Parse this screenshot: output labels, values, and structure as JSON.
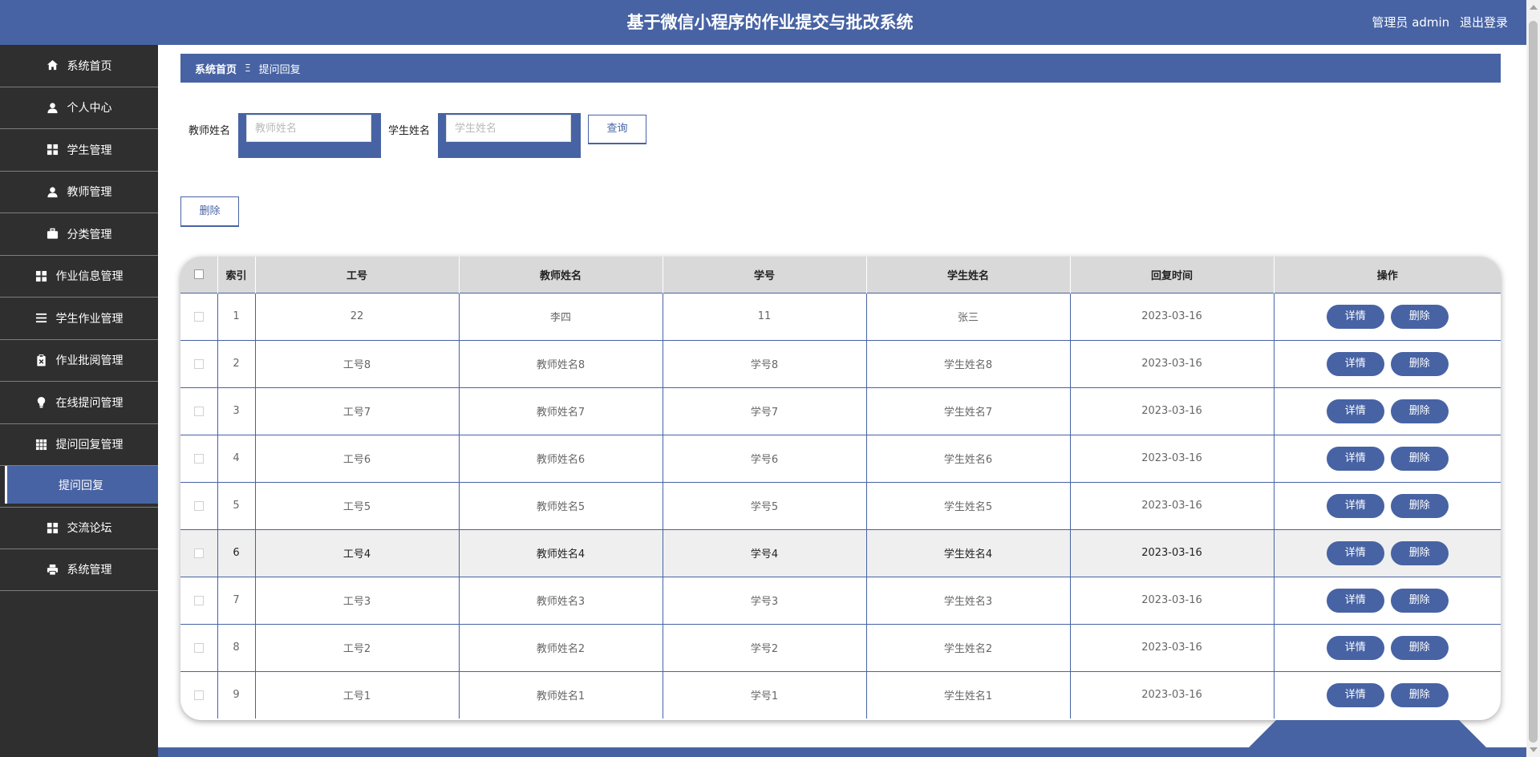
{
  "header": {
    "title": "基于微信小程序的作业提交与批改系统",
    "user": "管理员 admin",
    "logout": "退出登录"
  },
  "sidebar": {
    "items": [
      {
        "label": "系统首页",
        "icon": "home-icon"
      },
      {
        "label": "个人中心",
        "icon": "user-icon"
      },
      {
        "label": "学生管理",
        "icon": "grid-icon"
      },
      {
        "label": "教师管理",
        "icon": "user-icon"
      },
      {
        "label": "分类管理",
        "icon": "briefcase-icon"
      },
      {
        "label": "作业信息管理",
        "icon": "grid-icon"
      },
      {
        "label": "学生作业管理",
        "icon": "list-icon"
      },
      {
        "label": "作业批阅管理",
        "icon": "clipboard-icon"
      },
      {
        "label": "在线提问管理",
        "icon": "bulb-icon"
      },
      {
        "label": "提问回复管理",
        "icon": "table-icon"
      },
      {
        "label": "交流论坛",
        "icon": "grid-icon"
      },
      {
        "label": "系统管理",
        "icon": "printer-icon"
      }
    ],
    "active_sub": "提问回复"
  },
  "breadcrumb": {
    "home": "系统首页",
    "separator": "Ξ",
    "current": "提问回复"
  },
  "search": {
    "teacher_label": "教师姓名",
    "teacher_placeholder": "教师姓名",
    "teacher_value": "",
    "student_label": "学生姓名",
    "student_placeholder": "学生姓名",
    "student_value": "",
    "query_button": "查询"
  },
  "toolbar": {
    "delete_button": "删除"
  },
  "table": {
    "headers": [
      "索引",
      "工号",
      "教师姓名",
      "学号",
      "学生姓名",
      "回复时间",
      "操作"
    ],
    "rows": [
      {
        "index": "1",
        "gonghao": "22",
        "teacher": "李四",
        "xuehao": "11",
        "student": "张三",
        "time": "2023-03-16"
      },
      {
        "index": "2",
        "gonghao": "工号8",
        "teacher": "教师姓名8",
        "xuehao": "学号8",
        "student": "学生姓名8",
        "time": "2023-03-16"
      },
      {
        "index": "3",
        "gonghao": "工号7",
        "teacher": "教师姓名7",
        "xuehao": "学号7",
        "student": "学生姓名7",
        "time": "2023-03-16"
      },
      {
        "index": "4",
        "gonghao": "工号6",
        "teacher": "教师姓名6",
        "xuehao": "学号6",
        "student": "学生姓名6",
        "time": "2023-03-16"
      },
      {
        "index": "5",
        "gonghao": "工号5",
        "teacher": "教师姓名5",
        "xuehao": "学号5",
        "student": "学生姓名5",
        "time": "2023-03-16"
      },
      {
        "index": "6",
        "gonghao": "工号4",
        "teacher": "教师姓名4",
        "xuehao": "学号4",
        "student": "学生姓名4",
        "time": "2023-03-16"
      },
      {
        "index": "7",
        "gonghao": "工号3",
        "teacher": "教师姓名3",
        "xuehao": "学号3",
        "student": "学生姓名3",
        "time": "2023-03-16"
      },
      {
        "index": "8",
        "gonghao": "工号2",
        "teacher": "教师姓名2",
        "xuehao": "学号2",
        "student": "学生姓名2",
        "time": "2023-03-16"
      },
      {
        "index": "9",
        "gonghao": "工号1",
        "teacher": "教师姓名1",
        "xuehao": "学号1",
        "student": "学生姓名1",
        "time": "2023-03-16"
      }
    ],
    "detail_button": "详情",
    "delete_button": "删除"
  },
  "colors": {
    "primary": "#4763a4",
    "sidebar_bg": "#2f2f2f",
    "header_row": "#d9d9d9"
  }
}
